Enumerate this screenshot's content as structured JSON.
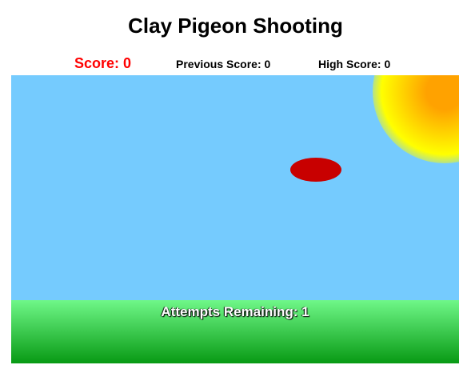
{
  "game": {
    "title": "Clay Pigeon Shooting",
    "score_label": "Score: 0",
    "previous_score_label": "Previous Score: 0",
    "high_score_label": "High Score: 0",
    "attempts_label": "Attempts Remaining: 1"
  },
  "colors": {
    "score_text": "#ff0000",
    "sky": "#75cbfe",
    "sun_core": "#ffa200",
    "sun_mid": "#ffff00",
    "pigeon": "#c80000",
    "ground_top": "#6ff788",
    "ground_bottom": "#089a14"
  },
  "icons": {
    "sun": "sun-icon",
    "pigeon": "clay-pigeon-icon"
  }
}
